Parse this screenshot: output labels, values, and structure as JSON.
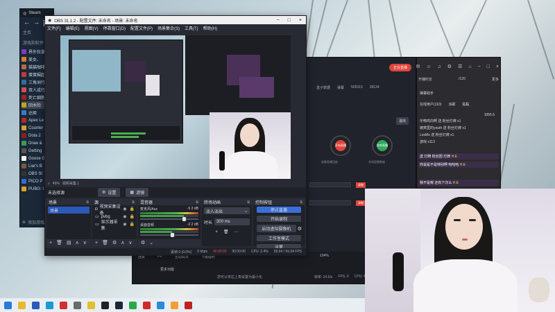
{
  "steam": {
    "title": "Steam",
    "nav_item": "商",
    "home": "主页",
    "library_section": "游戏和软件",
    "games": [
      {
        "name": "界外狂潮",
        "color": "#7a3cc4"
      },
      {
        "name": "美女、",
        "color": "#d08030"
      },
      {
        "name": "猫猫咖啡",
        "color": "#b36a4a"
      },
      {
        "name": "蛋蛋崛起",
        "color": "#c03a3a"
      },
      {
        "name": "三角洲行",
        "color": "#2d6fa0"
      },
      {
        "name": "双人成行",
        "color": "#d05050"
      },
      {
        "name": "死亡细胞",
        "color": "#a02020"
      },
      {
        "name": "回木险",
        "color": "#c9a020"
      },
      {
        "name": "达姬",
        "color": "#3a7ac0"
      },
      {
        "name": "Apex Le",
        "color": "#b02a2a"
      },
      {
        "name": "Counter",
        "color": "#d0a030"
      },
      {
        "name": "Dota 2",
        "color": "#8a1e1e"
      },
      {
        "name": "Draw &",
        "color": "#3a9a5a"
      },
      {
        "name": "Getting",
        "color": "#555555"
      },
      {
        "name": "Goose G",
        "color": "#f0f0f0"
      },
      {
        "name": "Liar's B",
        "color": "#7a5a3a"
      },
      {
        "name": "OBS St",
        "color": "#333333"
      },
      {
        "name": "PICO P",
        "color": "#3a6ad0"
      },
      {
        "name": "PUBG: I",
        "color": "#e0a020"
      }
    ],
    "add_game": "添加游戏"
  },
  "obs": {
    "title": "OBS 31.1.2 - 配置文件: 未命名 - 场景: 未命名",
    "menu": [
      "文件(F)",
      "编辑(E)",
      "视图(V)",
      "停靠窗口(D)",
      "配置文件(P)",
      "场景集合(S)",
      "工具(T)",
      "帮助(H)"
    ],
    "preview_toolbar": {
      "zoom": "45%",
      "source": "视频采集 1"
    },
    "mode_label": "未选择源",
    "mode_buttons": [
      "设置",
      "滤镜"
    ],
    "docks": {
      "scenes": {
        "title": "场景",
        "items": [
          "场景"
        ]
      },
      "sources": {
        "title": "源",
        "items": [
          "视频采集设备",
          "pvbg",
          "显示器采集"
        ]
      },
      "mixer": {
        "title": "混音器",
        "channels": [
          {
            "name": "麦克风/Aux",
            "db": "-5.3 dB",
            "level": 0.75
          },
          {
            "name": "桌面音频",
            "db": "-2.2 dB",
            "level": 0.55
          }
        ]
      },
      "transitions": {
        "title": "转场动画",
        "type": "淡入淡出",
        "duration_label": "时长",
        "duration": "300 ms"
      },
      "controls": {
        "title": "控制按钮",
        "buttons": [
          "停止直播",
          "开始录制",
          "启动虚拟摄像机",
          "工作室模式",
          "设置"
        ]
      }
    },
    "status": {
      "bitrate": "0 kbps",
      "time1": "00:00:00",
      "time2": "00:00:00",
      "cpu": "CPU: 2.4%",
      "fps": "59.94 / 59.94 FPS",
      "frames": "丢帧 0 (0.0%)"
    }
  },
  "tool": {
    "live_badge": "正在直播",
    "stats": [
      "盒子数据",
      "弹幕",
      "505313",
      "28134"
    ],
    "goal_label": "退出",
    "nodes": [
      "开始直播",
      "结束直播"
    ],
    "sub_left": "查看直播回放",
    "sub_right": "本场直播数据",
    "record": "录制",
    "bottom_icons": [
      "连麦",
      "PK",
      "互动玩法",
      "下播福利"
    ],
    "bottom_more": "更多功能",
    "tip": "您可以将右上角设置为最小化",
    "volume": "104%",
    "bitrate": "帧率: 24.6/s",
    "fps": "FPS: 0",
    "cpu": "CPU: 4%"
  },
  "chat": {
    "header_icons": [
      "✉",
      "☺",
      "♫",
      "⚙",
      "☰",
      "⌂",
      "−",
      "□",
      "×"
    ],
    "tab_left": "开播时长",
    "tab_count": "/120",
    "tab_right": "更多",
    "helper": "弹幕助手",
    "filters": [
      "在线用户(110)",
      "派歌",
      "贴黏"
    ],
    "count": "1055.5",
    "rows": [
      "乐鸭鸣向啊 送 粉丝灯牌 x1",
      "被窝里的youth 送 粉丝灯牌 x1",
      "LesMo 送 粉丝灯牌 x1",
      "游戏 x113"
    ],
    "danmu": [
      {
        "user": "H.E",
        "text": "送 灯牌 粉丝团 灯牌"
      },
      {
        "user": "H.E",
        "text": "你说是不是特别啊 哈哈哈"
      },
      {
        "user": "H.E",
        "text": "我不是嗯 还有下次么"
      }
    ]
  },
  "taskbar": {
    "icons": [
      {
        "name": "windows-icon",
        "color": "#2a7ad8"
      },
      {
        "name": "explorer-icon",
        "color": "#e8b830"
      },
      {
        "name": "store-icon",
        "color": "#2a5ab8"
      },
      {
        "name": "edge-icon",
        "color": "#1a9ad0"
      },
      {
        "name": "app-red-icon",
        "color": "#d03030"
      },
      {
        "name": "app-folder-icon",
        "color": "#6a6a6a"
      },
      {
        "name": "app-yellow-icon",
        "color": "#e0c030"
      },
      {
        "name": "obs-icon",
        "color": "#222222"
      },
      {
        "name": "steam-icon",
        "color": "#1b2838"
      },
      {
        "name": "wechat-icon",
        "color": "#2aa848"
      },
      {
        "name": "netease-icon",
        "color": "#d02a2a"
      },
      {
        "name": "app-blue-icon",
        "color": "#2a8ad8"
      },
      {
        "name": "app-cat-icon",
        "color": "#f0a030"
      },
      {
        "name": "app-red2-icon",
        "color": "#c02020"
      }
    ]
  }
}
